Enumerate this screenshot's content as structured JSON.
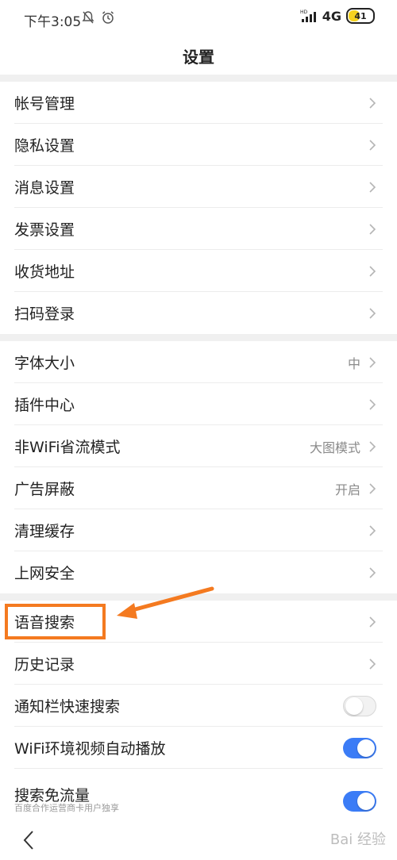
{
  "status_bar": {
    "time": "下午3:05",
    "network": "4G",
    "battery": "41"
  },
  "header": {
    "title": "设置"
  },
  "sections": {
    "account": [
      {
        "label": "帐号管理"
      },
      {
        "label": "隐私设置"
      },
      {
        "label": "消息设置"
      },
      {
        "label": "发票设置"
      },
      {
        "label": "收货地址"
      },
      {
        "label": "扫码登录"
      }
    ],
    "browse": [
      {
        "label": "字体大小",
        "value": "中"
      },
      {
        "label": "插件中心",
        "value": ""
      },
      {
        "label": "非WiFi省流模式",
        "value": "大图模式"
      },
      {
        "label": "广告屏蔽",
        "value": "开启"
      },
      {
        "label": "清理缓存",
        "value": ""
      },
      {
        "label": "上网安全",
        "value": ""
      }
    ],
    "search": [
      {
        "label": "语音搜索",
        "kind": "chevron"
      },
      {
        "label": "历史记录",
        "kind": "chevron"
      },
      {
        "label": "通知栏快速搜索",
        "kind": "toggle",
        "on": false
      },
      {
        "label": "WiFi环境视频自动播放",
        "kind": "toggle",
        "on": true
      },
      {
        "label": "搜索免流量",
        "kind": "toggle",
        "on": true,
        "sublabel": "百度合作运营商卡用户独享"
      }
    ]
  },
  "watermark": "Bai 经验",
  "colors": {
    "accent": "#3b7cf6",
    "highlight": "#f47a20"
  }
}
